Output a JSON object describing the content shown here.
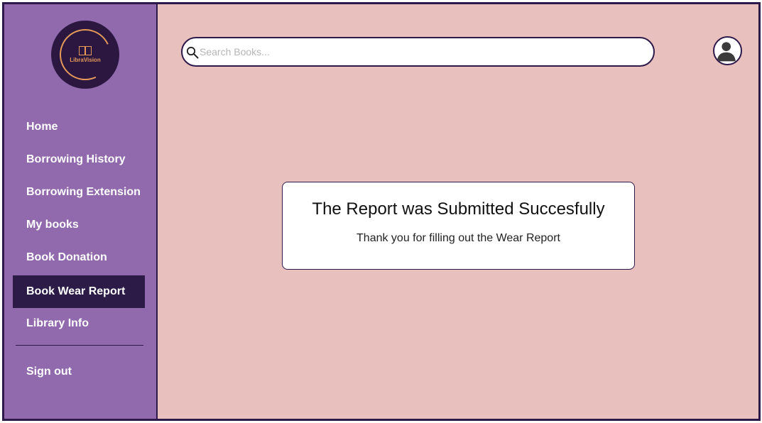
{
  "app": {
    "logo_text": "LibraVision"
  },
  "search": {
    "placeholder": "Search Books..."
  },
  "sidebar": {
    "items": [
      {
        "label": "Home"
      },
      {
        "label": "Borrowing History"
      },
      {
        "label": "Borrowing Extension"
      },
      {
        "label": "My books"
      },
      {
        "label": "Book Donation"
      },
      {
        "label": "Book Wear Report"
      },
      {
        "label": "Library Info"
      }
    ],
    "active_item": "Book Wear Report",
    "signout_label": "Sign out"
  },
  "dialog": {
    "title": "The Report was Submitted Succesfully",
    "message": "Thank you for filling out the Wear Report"
  },
  "icons": {
    "search": "search-icon",
    "avatar": "user-avatar-icon",
    "logo_book": "open-book-icon"
  },
  "colors": {
    "sidebar_bg": "#9169ad",
    "sidebar_active": "#2c1a47",
    "main_bg": "#e8c0bd",
    "border": "#2e1a4a",
    "logo_accent": "#e69a5a"
  }
}
